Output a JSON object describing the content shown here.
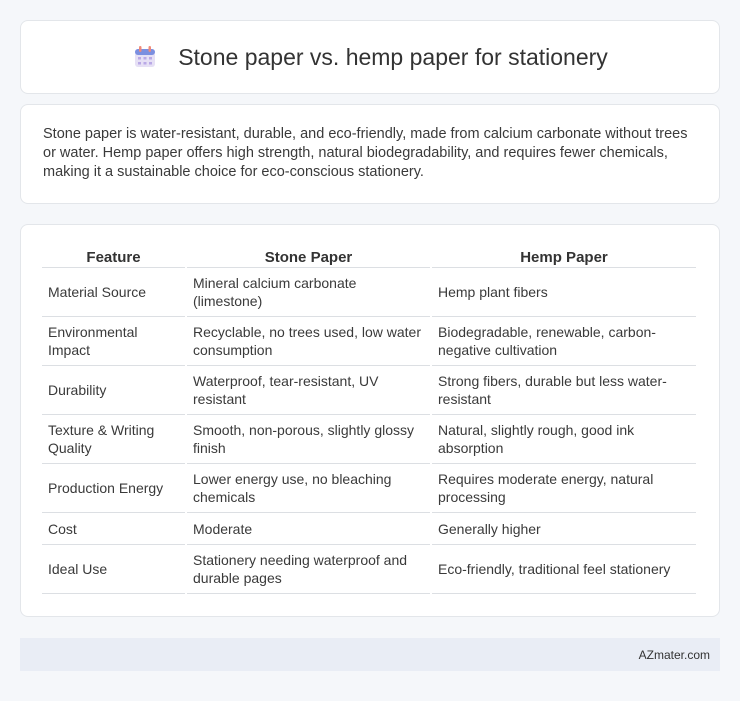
{
  "header": {
    "title": "Stone paper vs. hemp paper for stationery",
    "icon": "calendar-icon"
  },
  "summary": "Stone paper is water-resistant, durable, and eco-friendly, made from calcium carbonate without trees or water. Hemp paper offers high strength, natural biodegradability, and requires fewer chemicals, making it a sustainable choice for eco-conscious stationery.",
  "table": {
    "headers": [
      "Feature",
      "Stone Paper",
      "Hemp Paper"
    ],
    "rows": [
      [
        "Material Source",
        "Mineral calcium carbonate (limestone)",
        "Hemp plant fibers"
      ],
      [
        "Environmental Impact",
        "Recyclable, no trees used, low water consumption",
        "Biodegradable, renewable, carbon-negative cultivation"
      ],
      [
        "Durability",
        "Waterproof, tear-resistant, UV resistant",
        "Strong fibers, durable but less water-resistant"
      ],
      [
        "Texture & Writing Quality",
        "Smooth, non-porous, slightly glossy finish",
        "Natural, slightly rough, good ink absorption"
      ],
      [
        "Production Energy",
        "Lower energy use, no bleaching chemicals",
        "Requires moderate energy, natural processing"
      ],
      [
        "Cost",
        "Moderate",
        "Generally higher"
      ],
      [
        "Ideal Use",
        "Stationery needing waterproof and durable pages",
        "Eco-friendly, traditional feel stationery"
      ]
    ]
  },
  "footer": {
    "brand": "AZmater.com"
  }
}
